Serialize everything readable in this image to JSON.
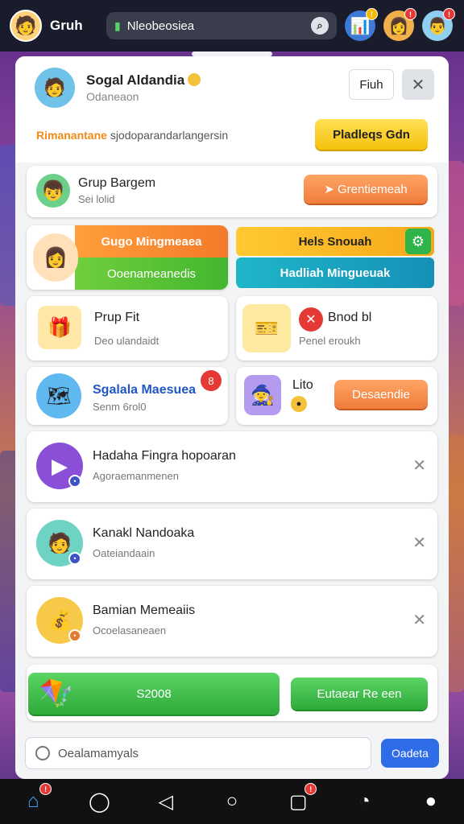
{
  "topbar": {
    "user_name": "Gruh",
    "search_text": "Nleobeosiea",
    "icons": [
      "leaderboard-icon",
      "friend-avatar-icon",
      "friend-avatar-icon"
    ]
  },
  "header": {
    "title": "Sogal Aldandia",
    "subtitle": "Odaneaon",
    "btn_white": "Fiuh",
    "promo_highlight": "Rimanantane",
    "promo_text": "sjodoparandarlangersin",
    "btn_yellow": "Pladleqs Gdn"
  },
  "group": {
    "title": "Grup Bargem",
    "subtitle": "Sei lolid",
    "button": "Grentiemeah"
  },
  "tiles": {
    "t1_top": "Gugo Mingmeaea",
    "t1_bottom": "Ooenameanedis",
    "t2_top": "Hels Snouah",
    "t2_bottom": "Hadliah Mingueuak",
    "t3_title": "Prup Fit",
    "t3_sub": "Deo ulandaidt",
    "t4_title": "Bnod bl",
    "t4_sub": "Penel eroukh",
    "t5_title": "Sgalala Maesuea",
    "t5_sub": "Senm 6rol0",
    "t6_title": "Lito",
    "t6_button": "Desaendie"
  },
  "list": [
    {
      "title": "Hadaha Fingra hopoaran",
      "subtitle": "Agoraemanmenen"
    },
    {
      "title": "Kanakl Nandoaka",
      "subtitle": "Oateiandaain"
    },
    {
      "title": "Bamian Memeaiis",
      "subtitle": "Ocoelasaneaen"
    }
  ],
  "reward": {
    "amount": "S2008",
    "button": "Eutaear Re een"
  },
  "chat": {
    "placeholder": "Oealamamyals",
    "send": "Oadeta"
  },
  "colors": {
    "accent_orange": "#f07c3a",
    "accent_green": "#2eaa3a",
    "accent_yellow": "#f5c10e",
    "accent_blue": "#2f6de8"
  }
}
